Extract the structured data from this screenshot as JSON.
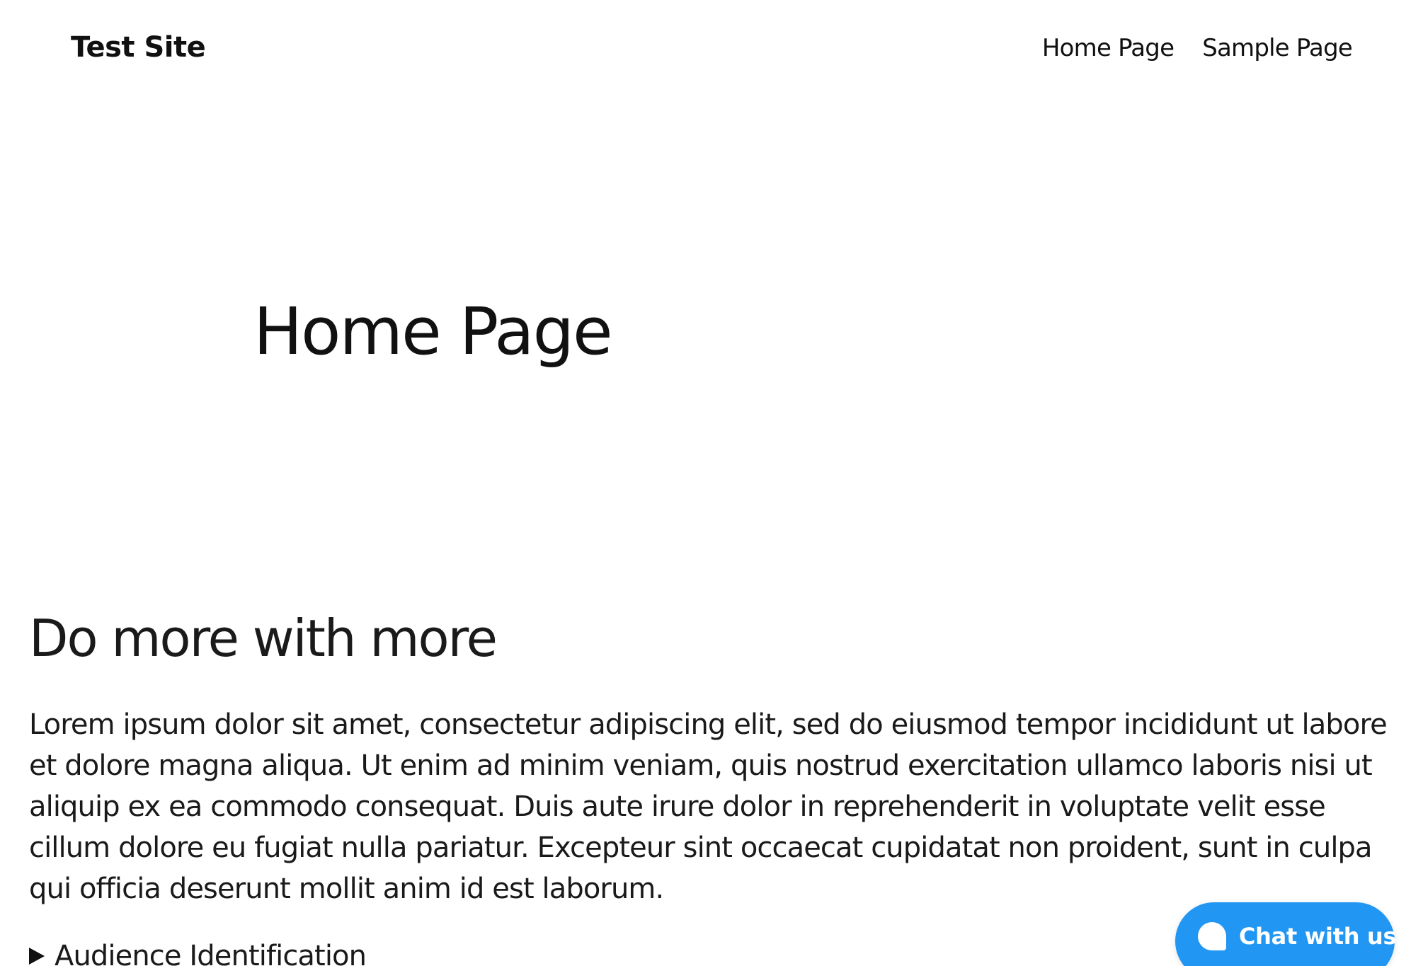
{
  "header": {
    "site_title": "Test Site",
    "nav": [
      {
        "label": "Home Page"
      },
      {
        "label": "Sample Page"
      }
    ]
  },
  "hero": {
    "title": "Home Page"
  },
  "content": {
    "heading": "Do more with more",
    "paragraph": "Lorem ipsum dolor sit amet, consectetur adipiscing elit, sed do eiusmod tempor incididunt ut labore et dolore magna aliqua. Ut enim ad minim veniam, quis nostrud exercitation ullamco laboris nisi ut aliquip ex ea commodo consequat. Duis aute irure dolor in reprehenderit in voluptate velit esse cillum dolore eu fugiat nulla pariatur. Excepteur sint occaecat cupidatat non proident, sunt in culpa qui officia deserunt mollit anim id est laborum.",
    "details_summary": "Audience Identification"
  },
  "chat": {
    "label": "Chat with us",
    "icon": "chat-bubble-icon",
    "color": "#2196f3"
  }
}
